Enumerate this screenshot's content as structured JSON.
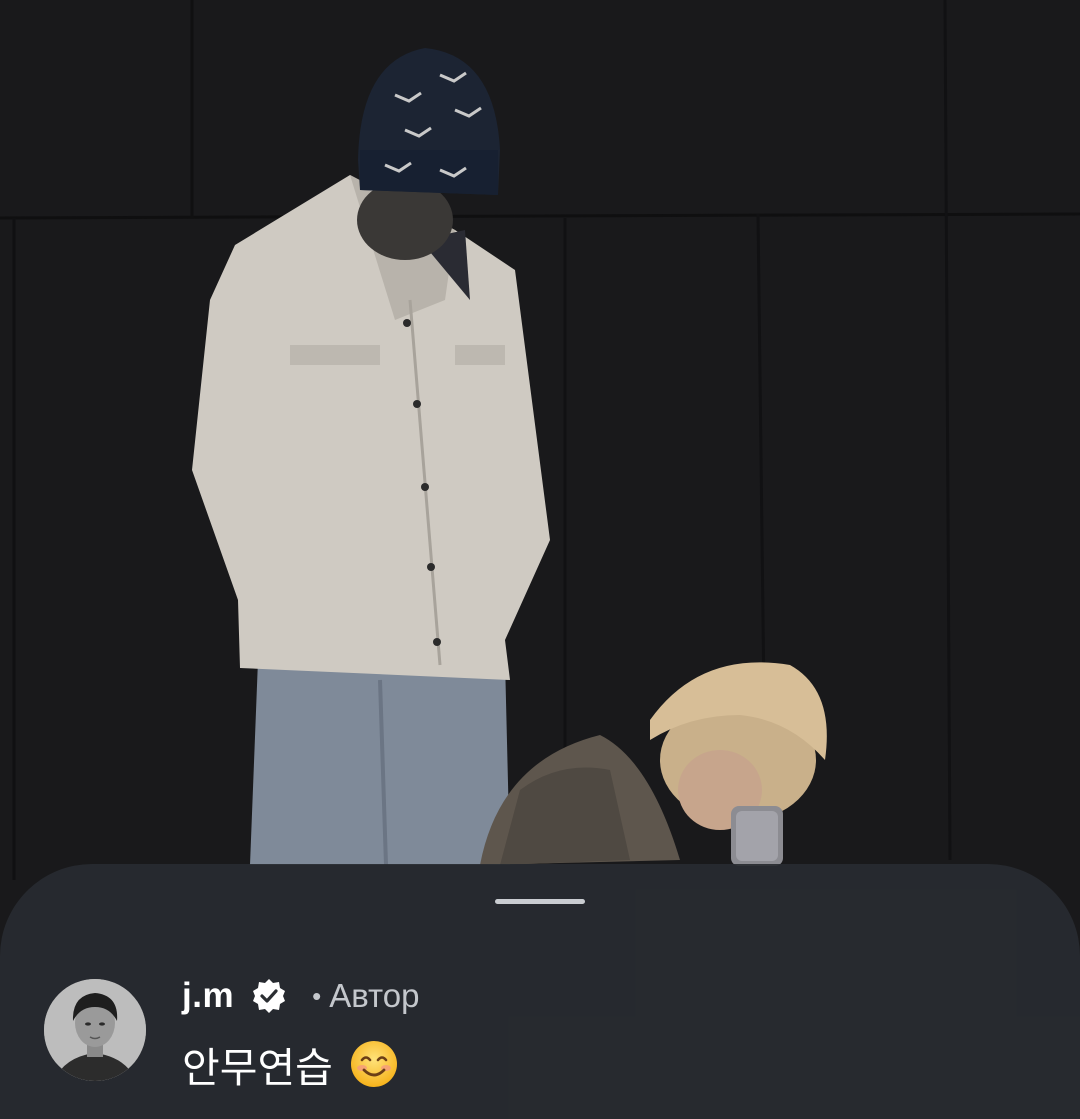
{
  "post": {
    "photo_icon": "dance-practice-photo"
  },
  "comment_sheet": {
    "handle_icon": "drag-handle",
    "author": {
      "username": "j.m",
      "verified_icon": "verified-badge-icon",
      "separator": "•",
      "badge": "Автор"
    },
    "caption": {
      "text": "안무연습",
      "emoji_icon": "smiling-face-icon"
    }
  }
}
